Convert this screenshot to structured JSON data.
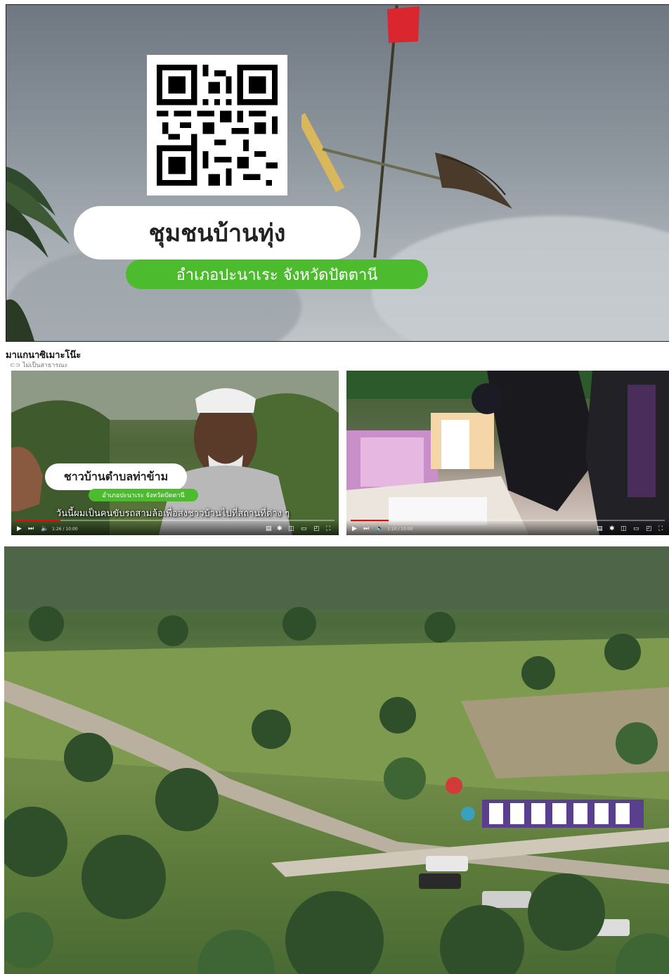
{
  "hero": {
    "title": "ชุมชนบ้านทุ่ง",
    "subtitle": "อำเภอปะนาเระ จังหวัดปัตตานี",
    "qr_code": "qr-code"
  },
  "channel": {
    "name": "มาแกนาซิเมาะโน๊ะ",
    "status": "ไม่เป็นสาธารณะ"
  },
  "video1": {
    "lower_third_title": "ชาวบ้านตำบลท่าข้าม",
    "lower_third_subtitle": "อำเภอปะนาเระ จังหวัดปัตตานี",
    "caption": "วันนี้ผมเป็นคนขับรถสามล้อเพื่อส่งชาวบ้านไปที่สถานที่ต่าง ๆ",
    "time": "1:26 / 10:00",
    "progress": 0.14
  },
  "video2": {
    "time": "1:10 / 10:00",
    "progress": 0.12
  },
  "colors": {
    "accent_green": "#4cbc2e",
    "progress_red": "#ff0000"
  },
  "icons": [
    "play-icon",
    "next-icon",
    "volume-icon",
    "subtitles-icon",
    "settings-icon",
    "miniplayer-icon",
    "theater-icon",
    "cast-icon",
    "fullscreen-icon"
  ]
}
